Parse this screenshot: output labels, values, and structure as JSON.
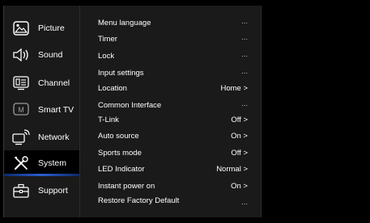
{
  "nav": {
    "items": [
      {
        "label": "Picture",
        "icon": "picture-icon"
      },
      {
        "label": "Sound",
        "icon": "speaker-icon"
      },
      {
        "label": "Channel",
        "icon": "channel-icon"
      },
      {
        "label": "Smart TV",
        "icon": "smart-tv-icon"
      },
      {
        "label": "Network",
        "icon": "network-icon"
      },
      {
        "label": "System",
        "icon": "tools-icon"
      },
      {
        "label": "Support",
        "icon": "toolbox-icon"
      }
    ],
    "selected": "System"
  },
  "menu": {
    "items": [
      {
        "label": "Menu language",
        "value": "..."
      },
      {
        "label": "Timer",
        "value": "..."
      },
      {
        "label": "Lock",
        "value": "..."
      },
      {
        "label": "Input settings",
        "value": "..."
      },
      {
        "label": "Location",
        "value": "Home >"
      },
      {
        "label": "Common Interface",
        "value": "..."
      },
      {
        "label": "T-Link",
        "value": "Off >"
      },
      {
        "label": "Auto source",
        "value": "On >"
      },
      {
        "label": "Sports mode",
        "value": "Off >"
      },
      {
        "label": "LED Indicator",
        "value": "Normal >"
      },
      {
        "label": "Instant power on",
        "value": "On >"
      },
      {
        "label": "Restore Factory Default",
        "value": "..."
      }
    ]
  },
  "colors": {
    "panel": "#1a1a1a",
    "background": "#000000",
    "accent": "#2a5fd0",
    "text": "#ffffff"
  }
}
